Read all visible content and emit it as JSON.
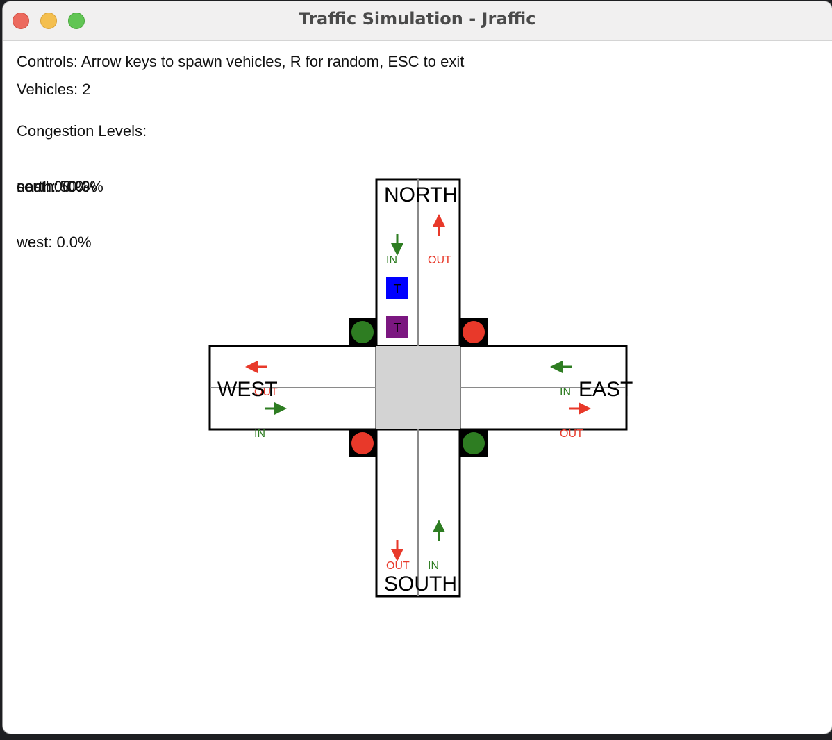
{
  "window": {
    "title": "Traffic Simulation - Jraffic"
  },
  "info": {
    "controls": "Controls: Arrow keys to spawn vehicles, R for random, ESC to exit",
    "vehicles": "Vehicles: 2",
    "congestion_heading": "Congestion Levels:",
    "overlapping_lines": [
      "north: 50.0%",
      "south: 0.0%",
      "east: 0.0%"
    ],
    "west_line": "west: 0.0%"
  },
  "roads": {
    "north_label": "NORTH",
    "south_label": "SOUTH",
    "east_label": "EAST",
    "west_label": "WEST",
    "in_label": "IN",
    "out_label": "OUT"
  },
  "vehicles": [
    {
      "label": "T",
      "color": "#0000ff"
    },
    {
      "label": "T",
      "color": "#7b1780"
    }
  ],
  "lights": {
    "nw": "green",
    "ne": "red",
    "sw": "red",
    "se": "green"
  },
  "colors": {
    "green": "#2e7d22",
    "red": "#e8392a",
    "intersection": "#d3d3d3",
    "lane_divider": "#8a8a8a"
  }
}
